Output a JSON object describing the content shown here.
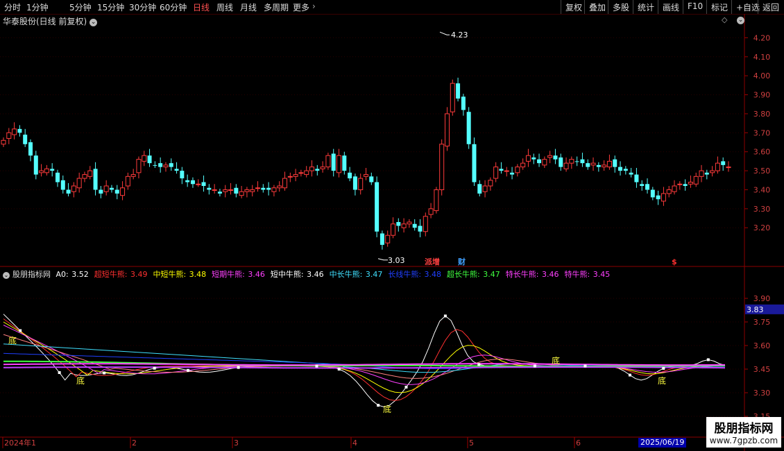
{
  "toolbar": {
    "periods": [
      {
        "label": "分时",
        "name": "period-minute-line"
      },
      {
        "label": "1分钟",
        "name": "period-1min"
      },
      {
        "label": "5分钟",
        "name": "period-5min"
      },
      {
        "label": "15分钟",
        "name": "period-15min"
      },
      {
        "label": "30分钟",
        "name": "period-30min"
      },
      {
        "label": "60分钟",
        "name": "period-60min"
      },
      {
        "label": "日线",
        "name": "period-daily"
      },
      {
        "label": "周线",
        "name": "period-weekly"
      },
      {
        "label": "月线",
        "name": "period-monthly"
      },
      {
        "label": "多周期",
        "name": "period-multi"
      },
      {
        "label": "更多",
        "name": "period-more"
      }
    ],
    "active_period": "日线",
    "right_buttons": [
      {
        "label": "复权",
        "name": "restore-rights-button"
      },
      {
        "label": "叠加",
        "name": "overlay-button"
      },
      {
        "label": "多股",
        "name": "multi-stock-button"
      },
      {
        "label": "统计",
        "name": "statistics-button"
      },
      {
        "label": "画线",
        "name": "draw-line-button"
      },
      {
        "label": "F10",
        "name": "f10-button"
      },
      {
        "label": "标记",
        "name": "mark-button"
      },
      {
        "label": "+自选",
        "name": "add-watchlist-button"
      },
      {
        "label": "返回",
        "name": "back-button"
      }
    ]
  },
  "stock": {
    "title": "华泰股份(日线 前复权)"
  },
  "price_chart": {
    "high_label": "4.23",
    "low_label": "3.03",
    "axis_ticks": [
      "4.20",
      "4.10",
      "4.00",
      "3.90",
      "3.80",
      "3.70",
      "3.60",
      "3.50",
      "3.40",
      "3.30",
      "3.20"
    ],
    "markers": [
      {
        "text": "派增",
        "color": "#ff4040"
      },
      {
        "text": "财",
        "color": "#40a0ff"
      },
      {
        "text": "$",
        "color": "#ff3030"
      }
    ],
    "up_color": "#ff3b3b",
    "down_color": "#54ffff",
    "low_gap_color": "#ffffff"
  },
  "indicator": {
    "name": "股朋指标网",
    "items": [
      {
        "label": "A0:",
        "value": "3.52",
        "color": "#ffffff"
      },
      {
        "label": "超短牛熊:",
        "value": "3.49",
        "color": "#ff3030"
      },
      {
        "label": "中短牛熊:",
        "value": "3.48",
        "color": "#ffff00"
      },
      {
        "label": "短期牛熊:",
        "value": "3.46",
        "color": "#ff40ff"
      },
      {
        "label": "短中牛熊:",
        "value": "3.46",
        "color": "#ffffff"
      },
      {
        "label": "中长牛熊:",
        "value": "3.47",
        "color": "#40e0ff"
      },
      {
        "label": "长线牛熊:",
        "value": "3.48",
        "color": "#2040ff"
      },
      {
        "label": "超长牛熊:",
        "value": "3.47",
        "color": "#40ff40"
      },
      {
        "label": "特长牛熊:",
        "value": "3.46",
        "color": "#ff40ff"
      },
      {
        "label": "特牛熊:",
        "value": "3.45",
        "color": "#ff40ff"
      }
    ],
    "axis_ticks": [
      "3.90",
      "3.75",
      "3.60",
      "3.45",
      "3.30",
      "3.15"
    ],
    "current_value": "3.83",
    "bottom_labels": [
      "底",
      "底",
      "底",
      "底",
      "底"
    ]
  },
  "time_axis": {
    "labels": [
      "2024年1",
      "2",
      "3",
      "4",
      "5",
      "6"
    ],
    "cursor_date": "2025/06/19"
  },
  "watermark": {
    "title": "股朋指标网",
    "url": "www.7gpzb.com"
  }
}
